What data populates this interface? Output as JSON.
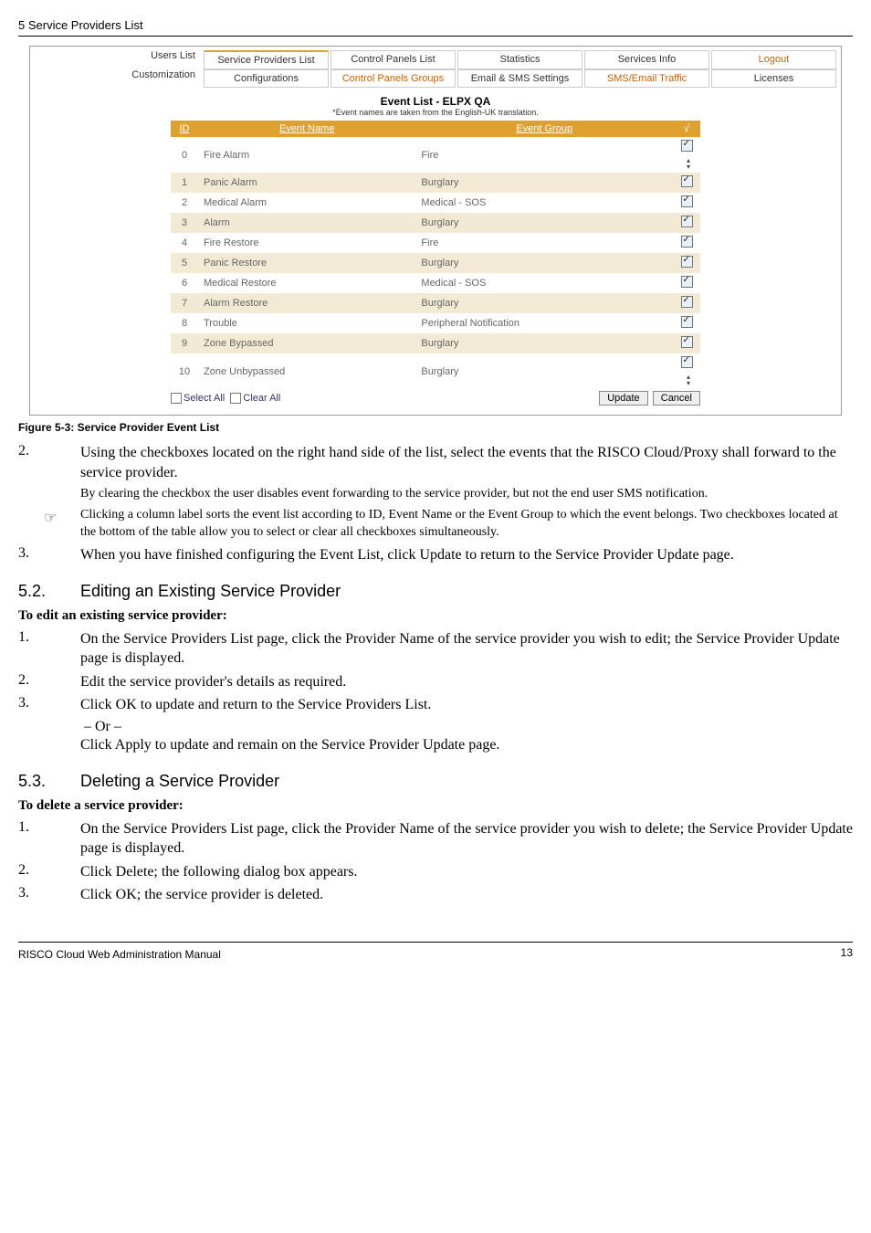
{
  "header": "5 Service Providers List",
  "screenshot": {
    "row1_label": "Users List",
    "row2_label": "Customization",
    "tabs1": [
      "Service Providers List",
      "Control Panels List",
      "Statistics",
      "Services Info",
      "Logout"
    ],
    "tabs2": [
      "Configurations",
      "Control Panels Groups",
      "Email & SMS Settings",
      "SMS/Email Traffic",
      "Licenses"
    ],
    "title": "Event List - ELPX QA",
    "subtitle": "*Event names are taken from the English-UK translation.",
    "cols": {
      "id": "ID",
      "name": "Event Name",
      "group": "Event Group",
      "chk": "√"
    },
    "rows": [
      {
        "id": "0",
        "name": "Fire Alarm",
        "group": "Fire"
      },
      {
        "id": "1",
        "name": "Panic Alarm",
        "group": "Burglary"
      },
      {
        "id": "2",
        "name": "Medical Alarm",
        "group": "Medical - SOS"
      },
      {
        "id": "3",
        "name": "Alarm",
        "group": "Burglary"
      },
      {
        "id": "4",
        "name": "Fire Restore",
        "group": "Fire"
      },
      {
        "id": "5",
        "name": "Panic Restore",
        "group": "Burglary"
      },
      {
        "id": "6",
        "name": "Medical Restore",
        "group": "Medical - SOS"
      },
      {
        "id": "7",
        "name": "Alarm Restore",
        "group": "Burglary"
      },
      {
        "id": "8",
        "name": "Trouble",
        "group": "Peripheral Notification"
      },
      {
        "id": "9",
        "name": "Zone Bypassed",
        "group": "Burglary"
      },
      {
        "id": "10",
        "name": "Zone Unbypassed",
        "group": "Burglary"
      }
    ],
    "select_all": "Select All",
    "clear_all": "Clear All",
    "update": "Update",
    "cancel": "Cancel"
  },
  "figcap": "Figure 5-3: Service Provider Event List",
  "p2": {
    "num": "2.",
    "text": "Using the checkboxes located on the right hand side of the list, select the events that the RISCO Cloud/Proxy shall forward to the service provider."
  },
  "note1": "By clearing the checkbox the user disables event forwarding to the service provider, but not the end user SMS notification.",
  "note2": "Clicking a column label sorts the event list according to ID, Event Name or the Event Group to which the event belongs. Two checkboxes located at the bottom of the table allow you to select or clear all checkboxes simultaneously.",
  "p3": {
    "num": "3.",
    "text": "When you have finished configuring the Event List, click Update to return to the Service Provider Update page."
  },
  "sec52": {
    "num": "5.2.",
    "title": "Editing an Existing Service Provider"
  },
  "sub52": "To edit an existing service provider:",
  "s52_1": {
    "num": "1.",
    "text": "On the Service Providers List page, click the Provider Name of the service provider you wish to edit; the Service Provider Update page is displayed."
  },
  "s52_2": {
    "num": "2.",
    "text": "Edit the service provider's details as required."
  },
  "s52_3": {
    "num": "3.",
    "text": "Click OK to update and return to the Service Providers List."
  },
  "or": " – Or –",
  "s52_or2": "Click Apply to update and remain on the Service Provider Update page.",
  "sec53": {
    "num": "5.3.",
    "title": "Deleting a Service Provider"
  },
  "sub53": "To delete a service provider:",
  "s53_1": {
    "num": "1.",
    "text": "On the Service Providers List page, click the Provider Name of the service provider you wish to delete; the Service Provider Update page is displayed."
  },
  "s53_2": {
    "num": "2.",
    "text": "Click Delete; the following dialog box appears."
  },
  "s53_3": {
    "num": "3.",
    "text": "Click OK; the service provider is deleted."
  },
  "footer_left": "RISCO Cloud Web Administration Manual",
  "footer_right": "13"
}
